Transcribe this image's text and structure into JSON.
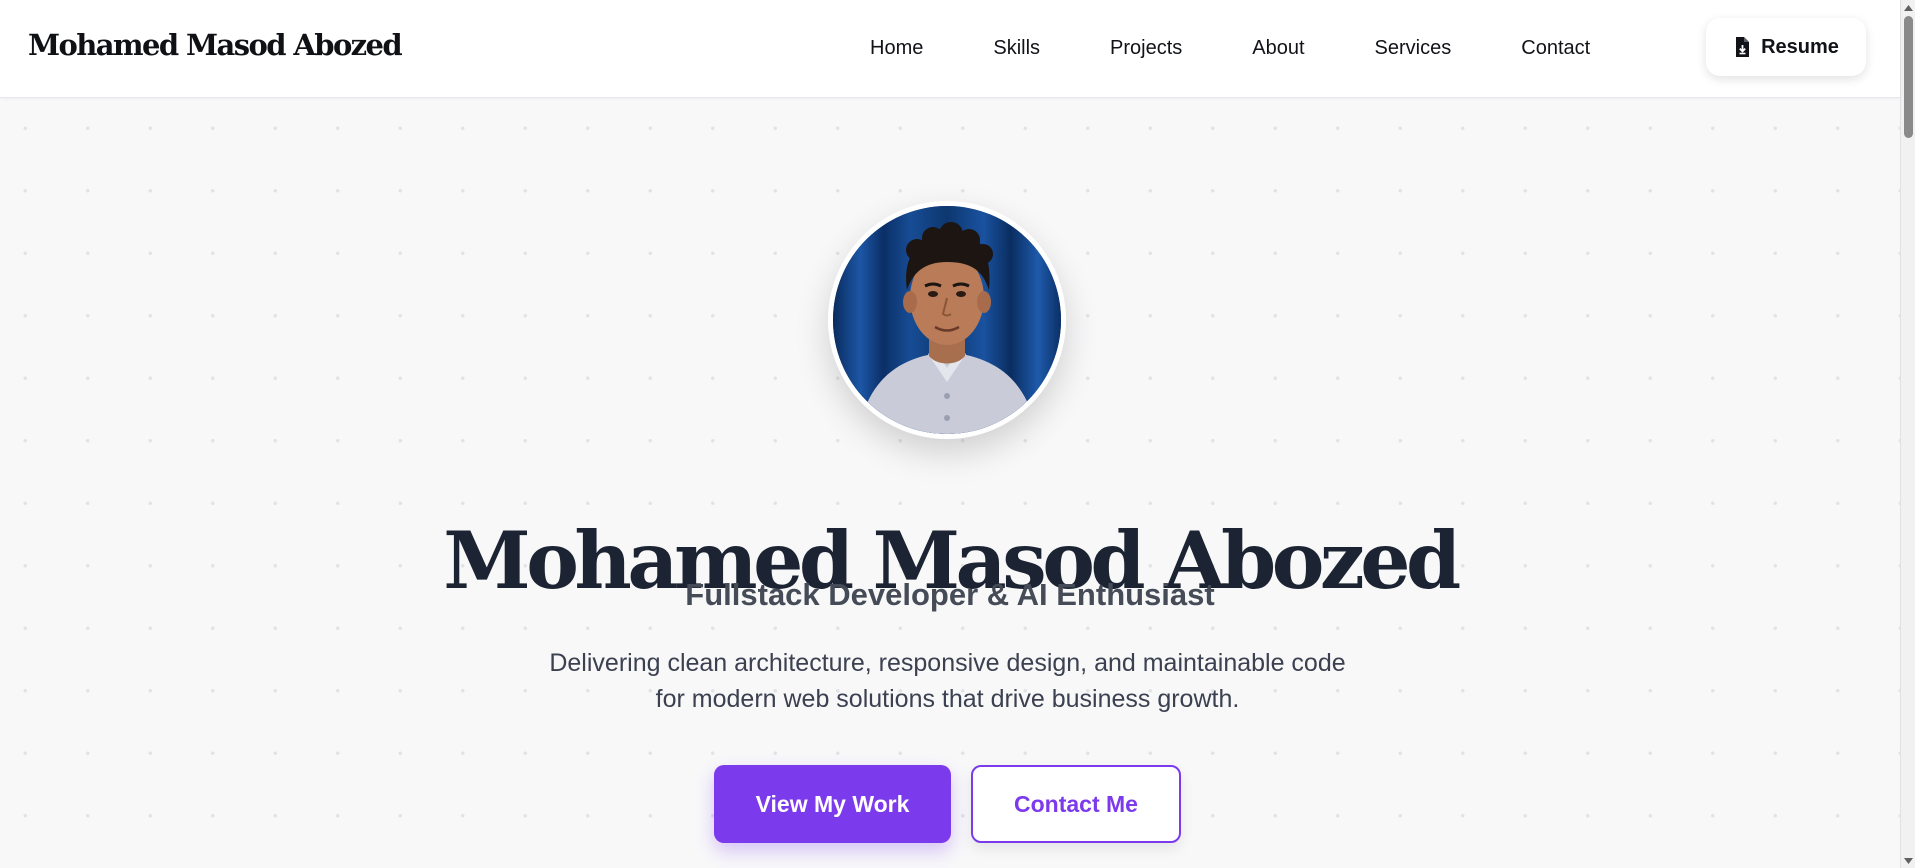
{
  "brand": {
    "name": "Mohamed Masod Abozed"
  },
  "nav": {
    "links": [
      "Home",
      "Skills",
      "Projects",
      "About",
      "Services",
      "Contact"
    ],
    "resume": {
      "label": "Resume",
      "icon": "file-download-icon"
    }
  },
  "hero": {
    "avatar_alt": "profile-photo",
    "title": "Mohamed Masod Abozed",
    "subtitle": "Fullstack Developer & AI Enthusiast",
    "description": "Delivering clean architecture, responsive design, and maintainable code for modern web solutions that drive business growth.",
    "primary_button": "View My Work",
    "secondary_button": "Contact Me"
  },
  "colors": {
    "accent": "#7c3aed",
    "heading": "#1c2433",
    "text": "#3b4150",
    "background": "#f8f8f9"
  }
}
